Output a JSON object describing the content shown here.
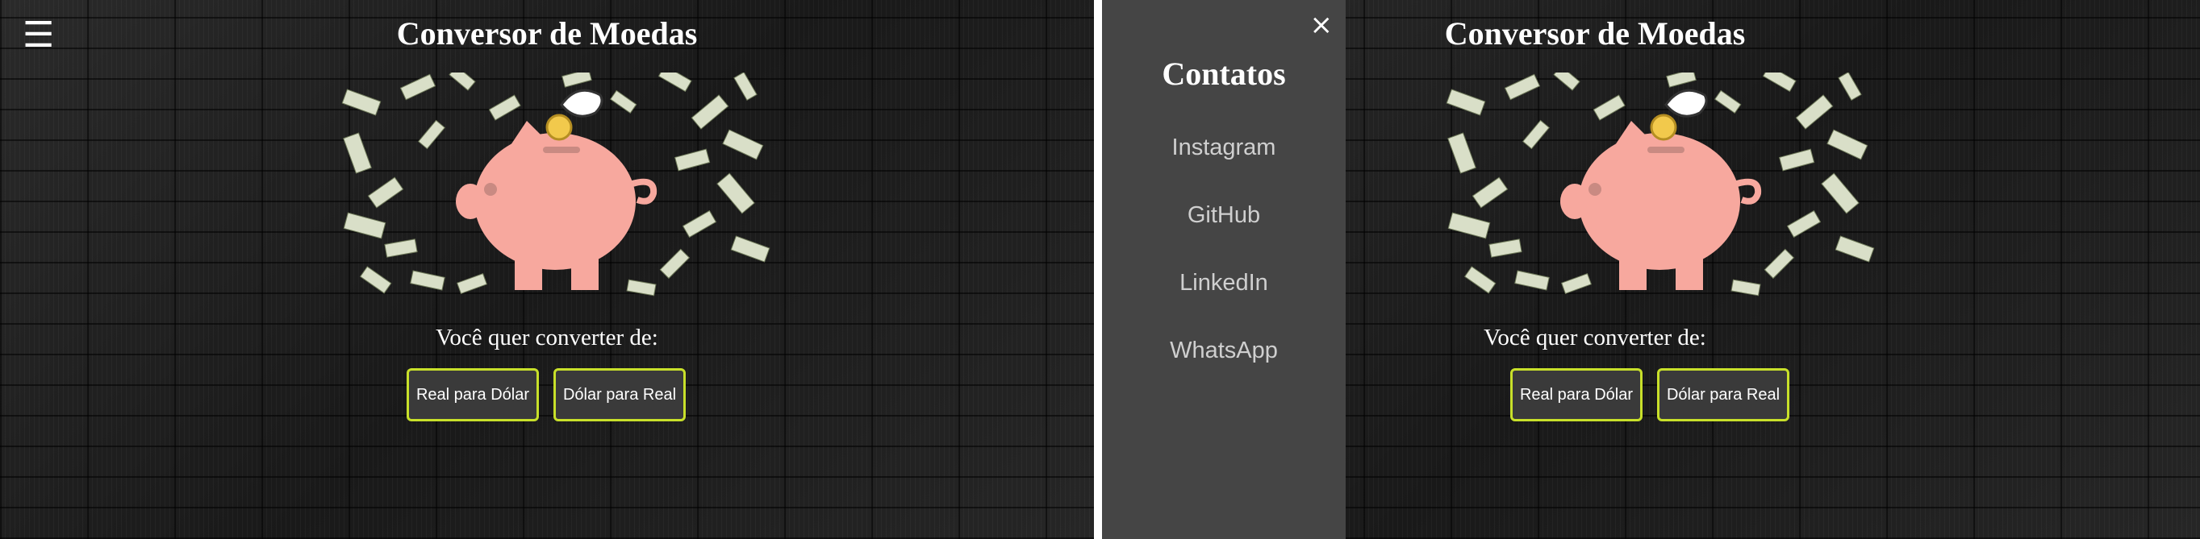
{
  "app": {
    "title": "Conversor de Moedas",
    "prompt": "Você quer converter de:",
    "buttons": {
      "real_to_dollar": "Real para Dólar",
      "dollar_to_real": "Dólar para Real"
    },
    "menu_icon": "☰"
  },
  "sidenav": {
    "title": "Contatos",
    "close_icon": "×",
    "links": [
      "Instagram",
      "GitHub",
      "LinkedIn",
      "WhatsApp"
    ]
  },
  "colors": {
    "button_border": "#c8e02a",
    "piggy": "#f7a89e",
    "coin": "#f2c94c",
    "sidenav_bg": "#454545"
  }
}
